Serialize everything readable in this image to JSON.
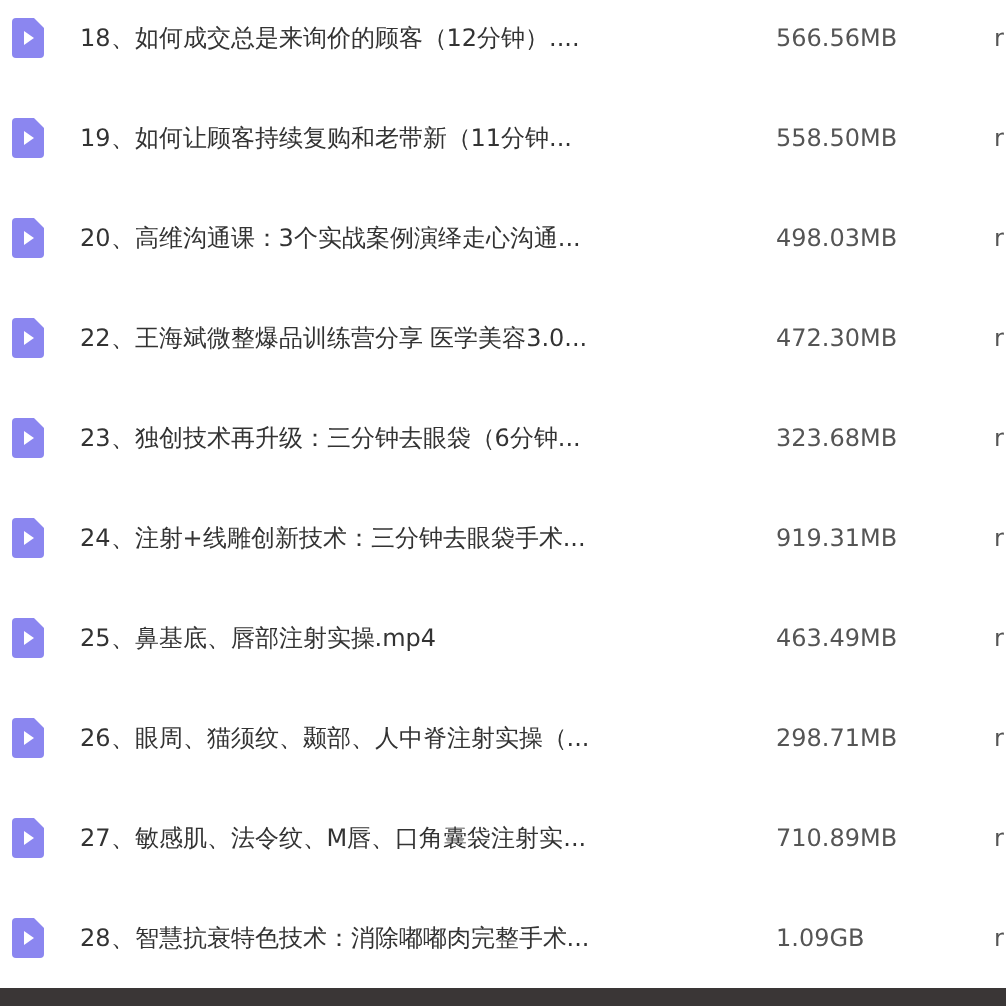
{
  "files": [
    {
      "name": "18、如何成交总是来询价的顾客（12分钟）....",
      "size": "566.56MB",
      "column_3": "r"
    },
    {
      "name": "19、如何让顾客持续复购和老带新（11分钟...",
      "size": "558.50MB",
      "column_3": "r"
    },
    {
      "name": "20、高维沟通课：3个实战案例演绎走心沟通...",
      "size": "498.03MB",
      "column_3": "r"
    },
    {
      "name": "22、王海斌微整爆品训练营分享 医学美容3.0...",
      "size": "472.30MB",
      "column_3": "r"
    },
    {
      "name": "23、独创技术再升级：三分钟去眼袋（6分钟...",
      "size": "323.68MB",
      "column_3": "r"
    },
    {
      "name": "24、注射+线雕创新技术：三分钟去眼袋手术...",
      "size": "919.31MB",
      "column_3": "r"
    },
    {
      "name": "25、鼻基底、唇部注射实操.mp4",
      "size": "463.49MB",
      "column_3": "r"
    },
    {
      "name": "26、眼周、猫须纹、颞部、人中脊注射实操（...",
      "size": "298.71MB",
      "column_3": "r"
    },
    {
      "name": "27、敏感肌、法令纹、M唇、口角囊袋注射实...",
      "size": "710.89MB",
      "column_3": "r"
    },
    {
      "name": "28、智慧抗衰特色技术：消除嘟嘟肉完整手术...",
      "size": "1.09GB",
      "column_3": "r"
    }
  ]
}
